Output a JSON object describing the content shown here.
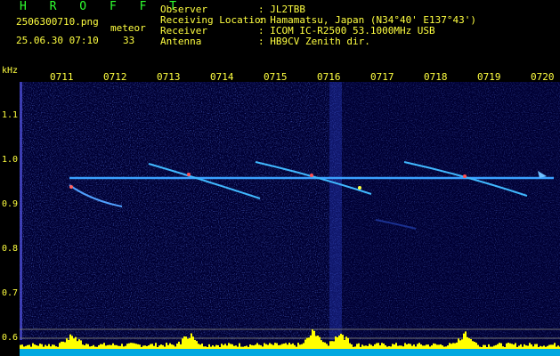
{
  "header": {
    "title": "H R O F F T",
    "filename": "2506300710.png",
    "datetime": "25.06.30 07:10",
    "mode_label": "meteor",
    "count": "33",
    "info": [
      {
        "label": "Observer",
        "value": ": JL2TBB"
      },
      {
        "label": "Receiving Location",
        "value": ": Hamamatsu, Japan (N34°40' E137°43')"
      },
      {
        "label": "Receiver",
        "value": ": ICOM IC-R2500 53.1000MHz USB"
      },
      {
        "label": "Antenna",
        "value": ": HB9CV Zenith dir."
      }
    ]
  },
  "axis": {
    "unit": "kHz",
    "times": [
      "0711",
      "0712",
      "0713",
      "0714",
      "0715",
      "0716",
      "0717",
      "0718",
      "0719",
      "0720"
    ],
    "freqs": [
      "1.1",
      "1.0",
      "0.9",
      "0.8",
      "0.7",
      "0.6"
    ]
  },
  "colors": {
    "label_yellow": "#ffff40",
    "label_green": "#2fff2f",
    "carrier": "#3aa0ff",
    "spectrum_bg": "#000066",
    "histogram": "#ffff00",
    "baseline": "#00c0ff"
  }
}
